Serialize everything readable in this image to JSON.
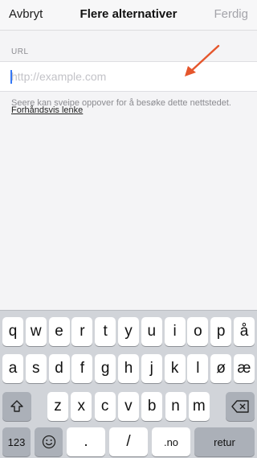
{
  "nav": {
    "cancel_label": "Avbryt",
    "title": "Flere alternativer",
    "done_label": "Ferdig"
  },
  "section": {
    "label": "URL"
  },
  "url_field": {
    "value": "",
    "placeholder": "http://example.com"
  },
  "helper": {
    "text": "Seere kan sveipe oppover for å besøke dette nettstedet.",
    "link_label": "Forhåndsvis lenke"
  },
  "keyboard": {
    "row1": [
      "q",
      "w",
      "e",
      "r",
      "t",
      "y",
      "u",
      "i",
      "o",
      "p",
      "å"
    ],
    "row2": [
      "a",
      "s",
      "d",
      "f",
      "g",
      "h",
      "j",
      "k",
      "l",
      "ø",
      "æ"
    ],
    "row3": [
      "z",
      "x",
      "c",
      "v",
      "b",
      "n",
      "m"
    ],
    "numbers_label": "123",
    "period_label": ".",
    "slash_label": "/",
    "tld_label": ".no",
    "return_label": "retur",
    "shift_icon": "shift-arrow-up-icon",
    "backspace_icon": "backspace-icon",
    "emoji_icon": "emoji-smiley-icon"
  },
  "colors": {
    "annotation_arrow": "#e5562c",
    "caret": "#3478f6",
    "done_disabled": "#a4a4aa",
    "keyboard_bg": "#d1d4d9"
  }
}
